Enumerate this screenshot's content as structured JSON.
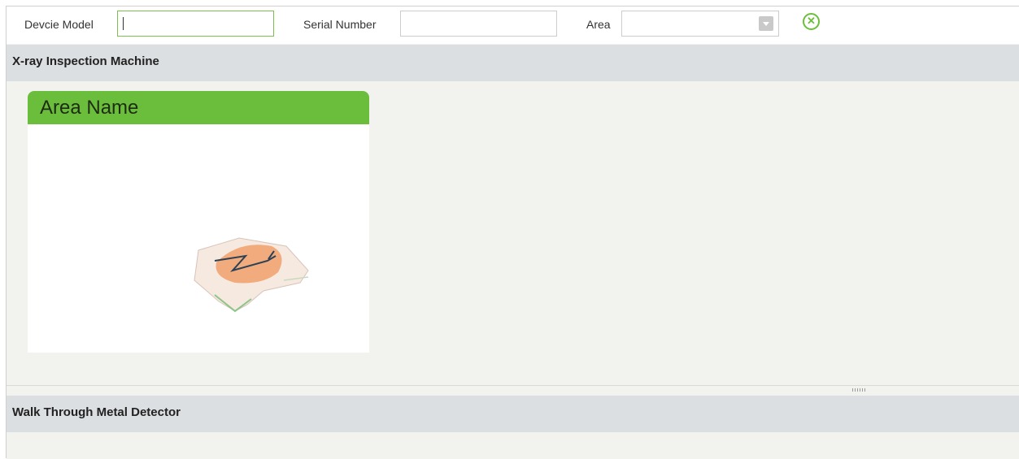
{
  "filters": {
    "device_model_label": "Devcie Model",
    "device_model_value": "",
    "serial_number_label": "Serial Number",
    "serial_number_value": "",
    "area_label": "Area",
    "area_value": ""
  },
  "sections": [
    {
      "title": "X-ray Inspection Machine",
      "cards": [
        {
          "title": "Area Name"
        }
      ]
    },
    {
      "title": "Walk Through Metal Detector",
      "cards": []
    }
  ],
  "icons": {
    "clear": "close-circle-icon",
    "dropdown": "chevron-down-icon"
  },
  "colors": {
    "accent": "#6bbe3c",
    "section_header_bg": "#dcdfe1",
    "body_bg": "#f2f3ef"
  }
}
